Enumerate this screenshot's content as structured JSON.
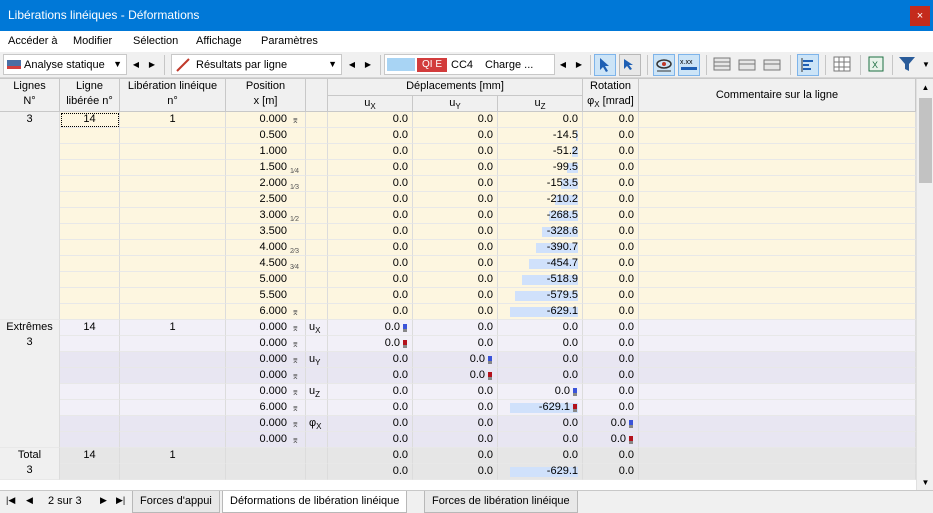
{
  "window": {
    "title": "Libérations linéiques - Déformations",
    "close": "×"
  },
  "menu": [
    "Accéder à",
    "Modifier",
    "Sélection",
    "Affichage",
    "Paramètres"
  ],
  "toolbar": {
    "analysis_combo": "Analyse statique",
    "results_combo": "Résultats par ligne",
    "ql_badge": "QI E",
    "lc_code": "CC4",
    "lc_name": "Charge ..."
  },
  "table": {
    "headers": {
      "lignes": [
        "Lignes",
        "N°"
      ],
      "ligne_liberee": [
        "Ligne",
        "libérée n°"
      ],
      "liberation": [
        "Libération linéique",
        "n°"
      ],
      "position": [
        "Position",
        "x [m]"
      ],
      "deplacements": "Déplacements [mm]",
      "ux": "u",
      "ux_sub": "X",
      "uy": "u",
      "uy_sub": "Y",
      "uz": "u",
      "uz_sub": "Z",
      "rotation": "Rotation",
      "phi": "φ",
      "phi_sub": "X",
      "phi_unit": " [mrad]",
      "comment": "Commentaire sur la ligne"
    },
    "group1": {
      "line": "3",
      "released_line": "14",
      "release": "1",
      "rows": [
        {
          "pos": "0.000",
          "mark": "⌆",
          "ux": "0.0",
          "uy": "0.0",
          "uz": "0.0",
          "phi": "0.0"
        },
        {
          "pos": "0.500",
          "mark": "",
          "ux": "0.0",
          "uy": "0.0",
          "uz": "-14.5",
          "phi": "0.0"
        },
        {
          "pos": "1.000",
          "mark": "",
          "ux": "0.0",
          "uy": "0.0",
          "uz": "-51.2",
          "phi": "0.0"
        },
        {
          "pos": "1.500",
          "mark": "1/4",
          "ux": "0.0",
          "uy": "0.0",
          "uz": "-99.5",
          "phi": "0.0"
        },
        {
          "pos": "2.000",
          "mark": "1/3",
          "ux": "0.0",
          "uy": "0.0",
          "uz": "-153.5",
          "phi": "0.0"
        },
        {
          "pos": "2.500",
          "mark": "",
          "ux": "0.0",
          "uy": "0.0",
          "uz": "-210.2",
          "phi": "0.0"
        },
        {
          "pos": "3.000",
          "mark": "1/2",
          "ux": "0.0",
          "uy": "0.0",
          "uz": "-268.5",
          "phi": "0.0"
        },
        {
          "pos": "3.500",
          "mark": "",
          "ux": "0.0",
          "uy": "0.0",
          "uz": "-328.6",
          "phi": "0.0"
        },
        {
          "pos": "4.000",
          "mark": "2/3",
          "ux": "0.0",
          "uy": "0.0",
          "uz": "-390.7",
          "phi": "0.0"
        },
        {
          "pos": "4.500",
          "mark": "3/4",
          "ux": "0.0",
          "uy": "0.0",
          "uz": "-454.7",
          "phi": "0.0"
        },
        {
          "pos": "5.000",
          "mark": "",
          "ux": "0.0",
          "uy": "0.0",
          "uz": "-518.9",
          "phi": "0.0"
        },
        {
          "pos": "5.500",
          "mark": "",
          "ux": "0.0",
          "uy": "0.0",
          "uz": "-579.5",
          "phi": "0.0"
        },
        {
          "pos": "6.000",
          "mark": "⌆",
          "ux": "0.0",
          "uy": "0.0",
          "uz": "-629.1",
          "phi": "0.0"
        }
      ]
    },
    "group2": {
      "line": [
        "Extrêmes",
        "3"
      ],
      "released_line": "14",
      "release": "1",
      "rows": [
        {
          "pos": "0.000",
          "mark": "⌆",
          "type": "u",
          "type_sub": "X",
          "ux": "0.0",
          "uy": "0.0",
          "uz": "0.0",
          "phi": "0.0",
          "ind": "ux",
          "indc": "#3a53d9"
        },
        {
          "pos": "0.000",
          "mark": "⌆",
          "type": "",
          "type_sub": "",
          "ux": "0.0",
          "uy": "0.0",
          "uz": "0.0",
          "phi": "0.0",
          "ind": "ux",
          "indc": "#b3121c"
        },
        {
          "pos": "0.000",
          "mark": "⌆",
          "type": "u",
          "type_sub": "Y",
          "ux": "0.0",
          "uy": "0.0",
          "uz": "0.0",
          "phi": "0.0",
          "ind": "uy",
          "indc": "#3a53d9"
        },
        {
          "pos": "0.000",
          "mark": "⌆",
          "type": "",
          "type_sub": "",
          "ux": "0.0",
          "uy": "0.0",
          "uz": "0.0",
          "phi": "0.0",
          "ind": "uy",
          "indc": "#b3121c"
        },
        {
          "pos": "0.000",
          "mark": "⌆",
          "type": "u",
          "type_sub": "Z",
          "ux": "0.0",
          "uy": "0.0",
          "uz": "0.0",
          "phi": "0.0",
          "ind": "uz",
          "indc": "#3a53d9"
        },
        {
          "pos": "6.000",
          "mark": "⌆",
          "type": "",
          "type_sub": "",
          "ux": "0.0",
          "uy": "0.0",
          "uz": "-629.1",
          "phi": "0.0",
          "ind": "uz",
          "indc": "#b3121c"
        },
        {
          "pos": "0.000",
          "mark": "⌆",
          "type": "φ",
          "type_sub": "X",
          "ux": "0.0",
          "uy": "0.0",
          "uz": "0.0",
          "phi": "0.0",
          "ind": "phi",
          "indc": "#3a53d9"
        },
        {
          "pos": "0.000",
          "mark": "⌆",
          "type": "",
          "type_sub": "",
          "ux": "0.0",
          "uy": "0.0",
          "uz": "0.0",
          "phi": "0.0",
          "ind": "phi",
          "indc": "#b3121c"
        }
      ]
    },
    "group3": {
      "line": [
        "Total",
        "3"
      ],
      "released_line": "14",
      "release": "1",
      "rows": [
        {
          "ux": "0.0",
          "uy": "0.0",
          "uz": "0.0",
          "phi": "0.0"
        },
        {
          "ux": "0.0",
          "uy": "0.0",
          "uz": "-629.1",
          "phi": "0.0"
        }
      ]
    },
    "uz_max_abs": 629.1
  },
  "bottom": {
    "page": "2 sur 3",
    "tabs": [
      "Forces d'appui",
      "Déformations de libération linéique",
      "Forces de libération linéique"
    ],
    "active_tab": 1
  }
}
